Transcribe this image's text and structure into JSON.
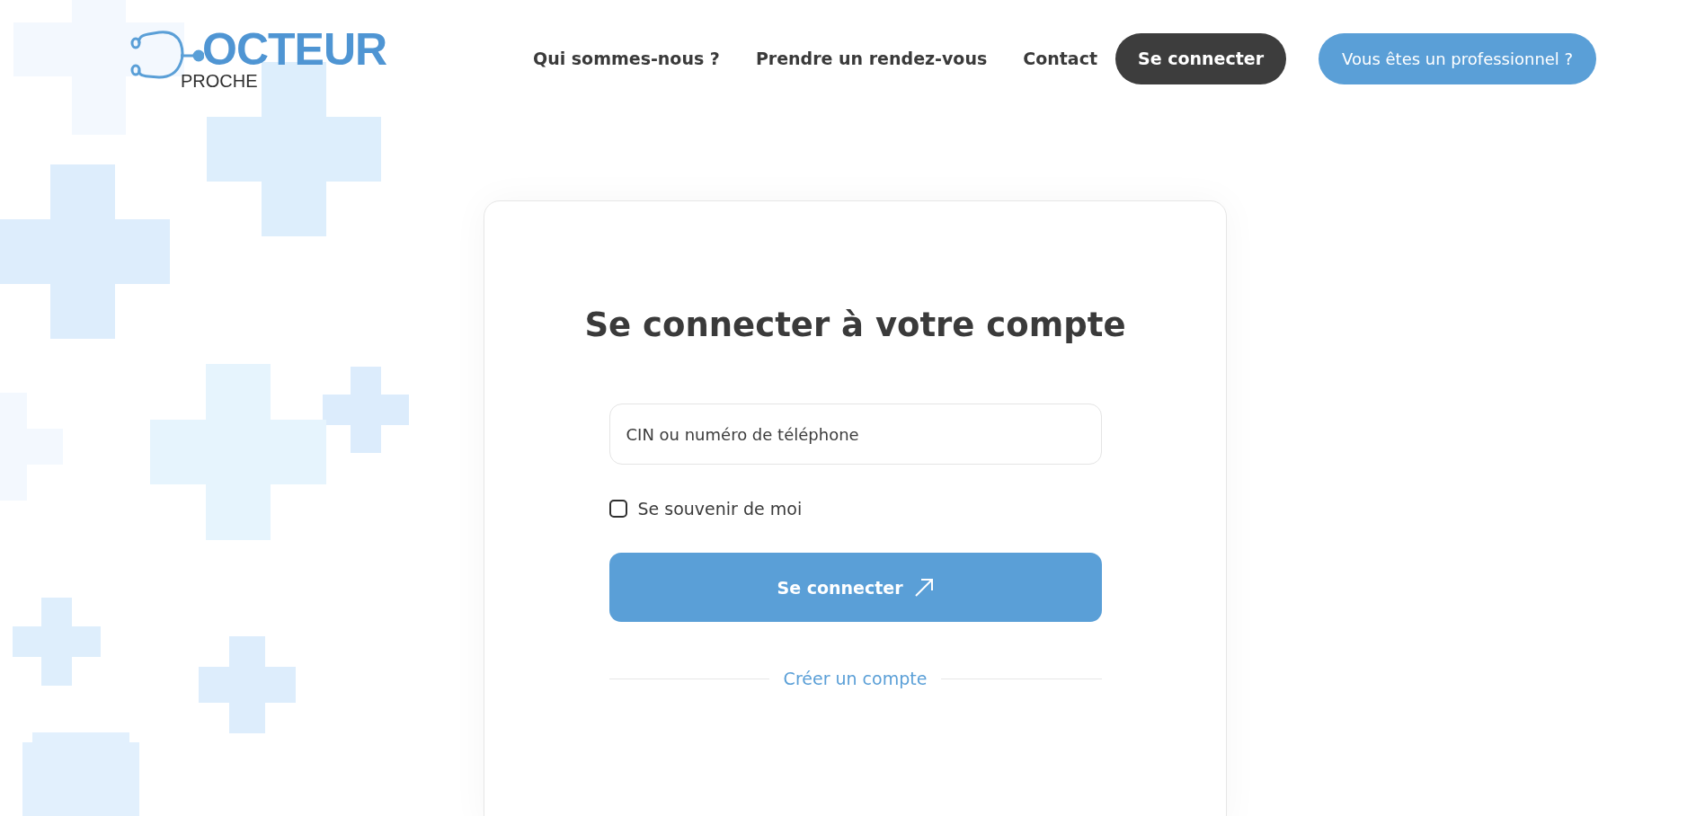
{
  "logo": {
    "title": "OCTEUR",
    "subtitle": "PROCHE"
  },
  "nav": [
    {
      "label": "Qui sommes-nous ?",
      "kind": "link"
    },
    {
      "label": "Prendre un rendez-vous",
      "kind": "link"
    },
    {
      "label": "Contact",
      "kind": "link"
    },
    {
      "label": "Se connecter",
      "kind": "dark"
    },
    {
      "label": "Vous êtes un professionnel ?",
      "kind": "primary"
    }
  ],
  "login": {
    "title": "Se connecter à votre compte",
    "field": {
      "placeholder": "CIN ou numéro de téléphone"
    },
    "remember": {
      "label": "Se souvenir de moi",
      "checked": false
    },
    "submit": "Se connecter",
    "create_account": "Créer un compte"
  }
}
